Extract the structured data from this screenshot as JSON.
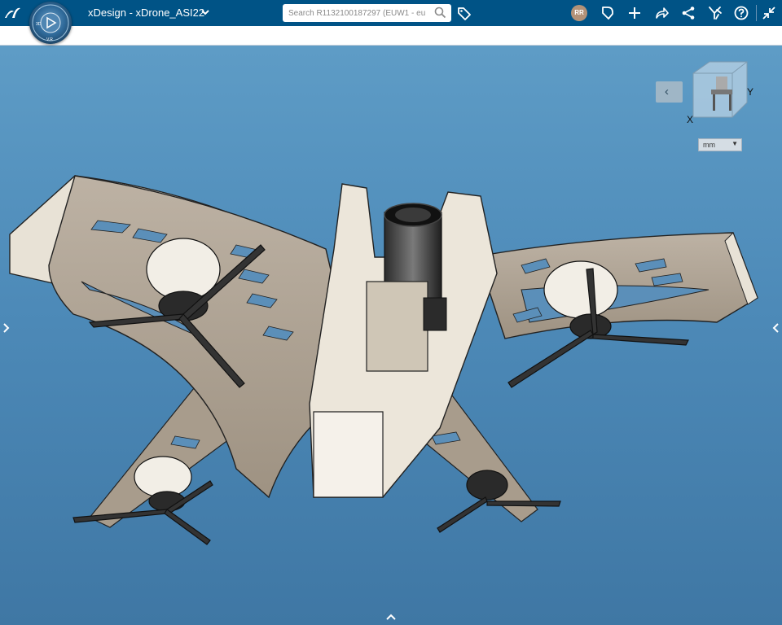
{
  "topbar": {
    "app_title": "xDesign - xDrone_ASI22",
    "search_placeholder": "Search R1132100187297 (EUW1 - eu",
    "avatar_initials": "RR",
    "brand_color": "#005386"
  },
  "compass": {
    "labels": [
      "3D",
      "V.R"
    ]
  },
  "viewport": {
    "units_value": "mm",
    "axis_x_label": "X",
    "axis_y_label": "Y",
    "background_color": "#4d8ab8"
  },
  "icons": {
    "brand": "3ds-logo-icon",
    "compass": "compass-icon",
    "title_menu": "chevron-down-icon",
    "search": "search-icon",
    "tags": "tag-icon",
    "share": "share-icon",
    "add": "plus-icon",
    "forward": "forward-icon",
    "network": "network-icon",
    "tools": "tools-icon",
    "help": "help-icon",
    "collapse": "collapse-icon"
  }
}
